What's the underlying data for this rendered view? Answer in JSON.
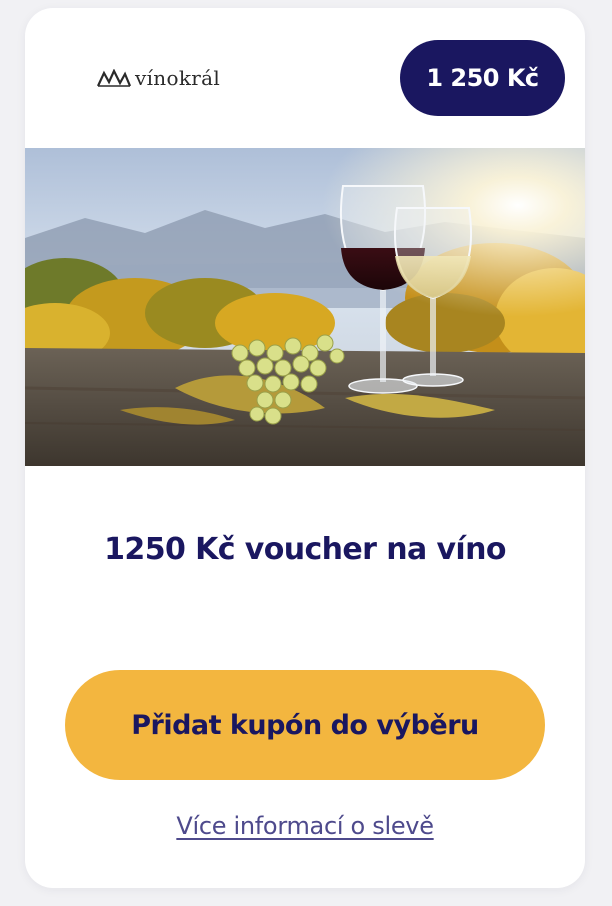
{
  "brand": {
    "logo_text": "vínokrál",
    "logo_icon": "mountain-peaks-icon"
  },
  "price_badge": "1 250 Kč",
  "hero_image": {
    "subject": "wine-glasses-and-grapes-photo"
  },
  "title": "1250 Kč voucher na víno",
  "cta_label": "Přidat kupón do výběru",
  "more_info_link": "Více informací o slevě",
  "colors": {
    "navy": "#1a1760",
    "accent": "#f3b63f",
    "link": "#4e4a8c",
    "card_bg": "#ffffff",
    "page_bg": "#f1f1f4"
  }
}
